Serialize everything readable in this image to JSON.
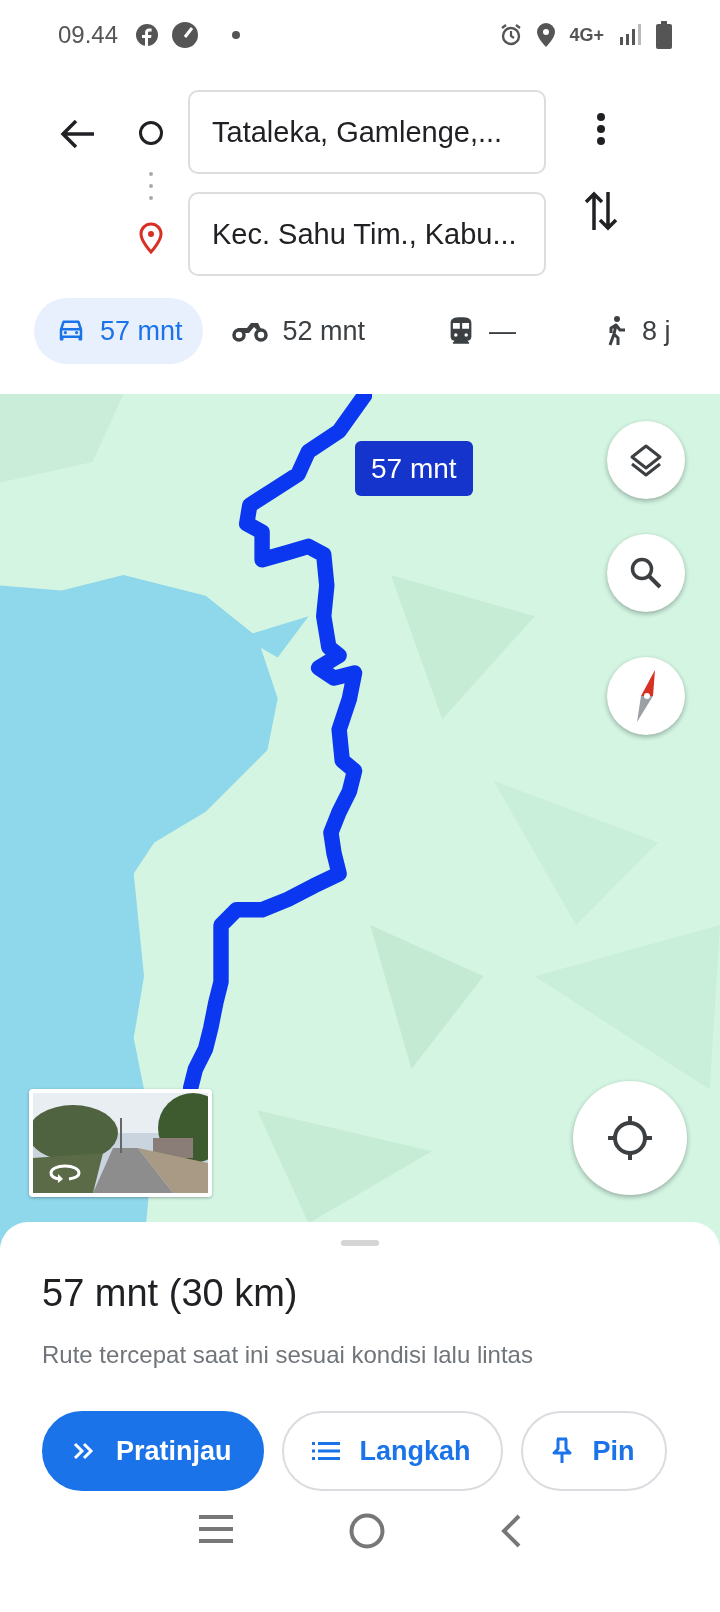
{
  "status_bar": {
    "time": "09.44",
    "network": "4G+"
  },
  "search": {
    "origin": "Tataleka, Gamlenge,...",
    "destination": "Kec. Sahu Tim., Kabu..."
  },
  "modes": [
    {
      "kind": "car",
      "label": "57 mnt",
      "selected": true
    },
    {
      "kind": "motorbike",
      "label": "52 mnt",
      "selected": false
    },
    {
      "kind": "transit",
      "label": "—",
      "selected": false
    },
    {
      "kind": "walk",
      "label": "8 j",
      "selected": false
    }
  ],
  "map": {
    "route_label": "57 mnt"
  },
  "sheet": {
    "title": "57 mnt (30 km)",
    "subtitle": "Rute tercepat saat ini sesuai kondisi lalu lintas",
    "actions": [
      {
        "kind": "preview",
        "label": "Pratinjau",
        "primary": true
      },
      {
        "kind": "steps",
        "label": "Langkah",
        "primary": false
      },
      {
        "kind": "pin",
        "label": "Pin",
        "primary": false
      }
    ]
  }
}
